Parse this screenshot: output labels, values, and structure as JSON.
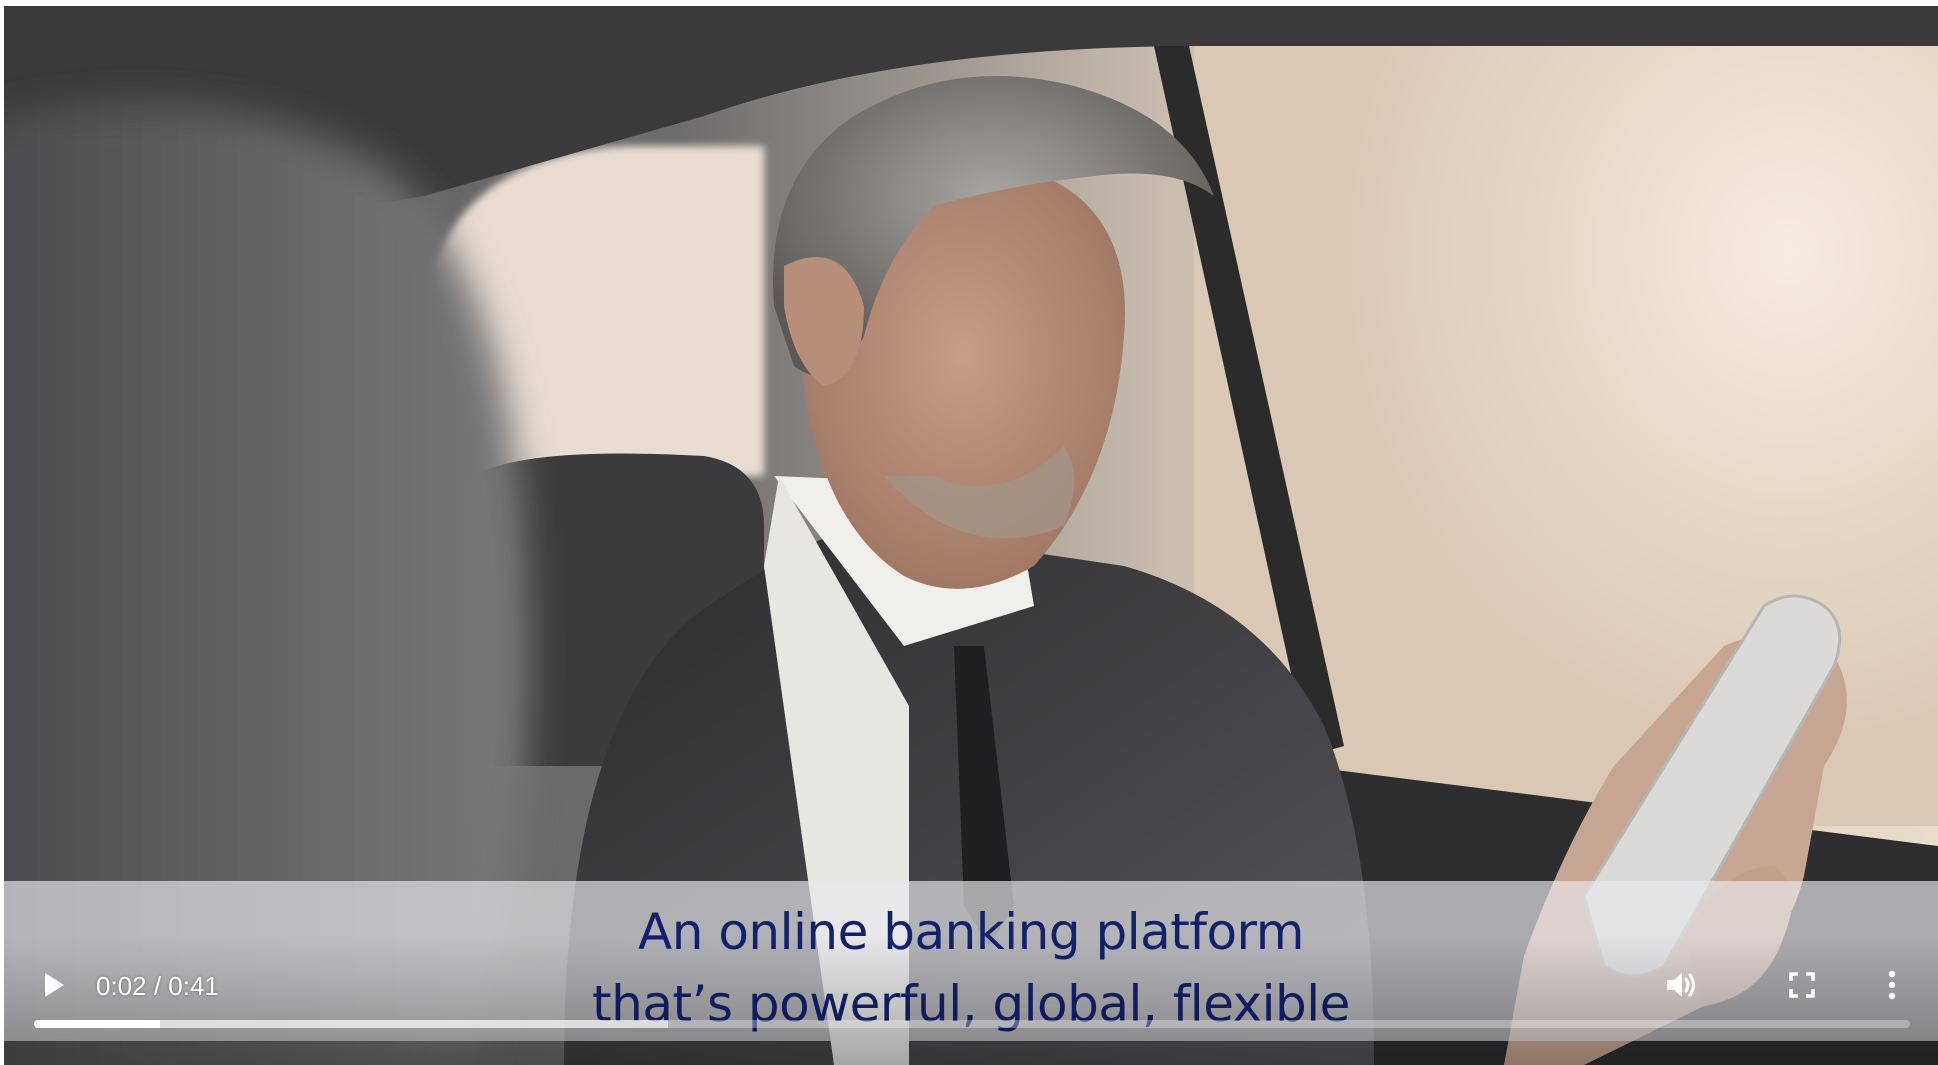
{
  "caption": {
    "line1": "An online banking platform",
    "line2": "that’s powerful, global, flexible"
  },
  "player": {
    "time_display": "0:02 / 0:41",
    "current_time": "0:02",
    "duration": "0:41",
    "played_fraction": 0.067,
    "buffered_fraction": 0.338,
    "state": "paused",
    "icons": {
      "play": "play-icon",
      "volume": "volume-icon",
      "fullscreen": "fullscreen-icon",
      "menu": "more-options-icon"
    }
  },
  "colors": {
    "caption_text": "#13216b",
    "caption_band": "#e8e8ec",
    "controls": "#ffffff"
  }
}
